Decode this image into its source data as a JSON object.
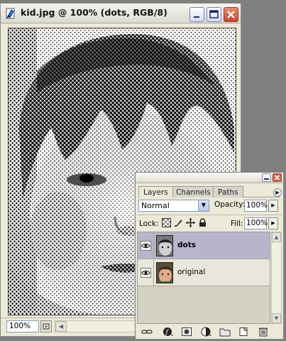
{
  "document": {
    "title": "kid.jpg @ 100% (dots, RGB/8)",
    "zoom": "100%"
  },
  "layers_palette": {
    "tabs": [
      {
        "label": "Layers",
        "active": true
      },
      {
        "label": "Channels",
        "active": false
      },
      {
        "label": "Paths",
        "active": false
      }
    ],
    "blend_mode": "Normal",
    "opacity_label": "Opacity:",
    "opacity_value": "100%",
    "lock_label": "Lock:",
    "fill_label": "Fill:",
    "fill_value": "100%",
    "layers": [
      {
        "name": "dots",
        "selected": true,
        "visible": true
      },
      {
        "name": "original",
        "selected": false,
        "visible": true
      }
    ],
    "bottom_icons": [
      "link-icon",
      "layer-style-icon",
      "add-mask-icon",
      "adjustment-layer-icon",
      "new-group-icon",
      "new-layer-icon",
      "trash-icon"
    ]
  },
  "colors": {
    "desktop": "#7f7f7f",
    "window_chrome": "#ece9d8",
    "selected_layer": "#b6b5c9",
    "close_button": "#c9462d"
  }
}
